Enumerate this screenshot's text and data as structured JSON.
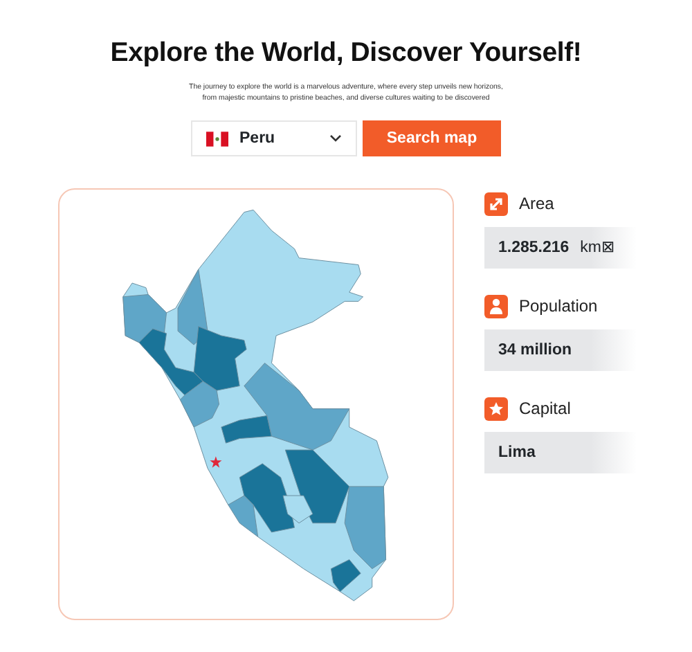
{
  "title": "Explore the World, Discover Yourself!",
  "subtitle_lines": [
    "The journey to explore the world is a marvelous adventure, where every step unveils new horizons,",
    "from majestic mountains to pristine beaches, and diverse cultures waiting to be discovered"
  ],
  "country_select": {
    "value": "Peru"
  },
  "search_button": "Search map",
  "facts": [
    {
      "kind": "area",
      "label": "Area",
      "value": "1.285.216",
      "unit": "km⊠"
    },
    {
      "kind": "population",
      "label": "Population",
      "value": "34 million"
    },
    {
      "kind": "capital",
      "label": "Capital",
      "value": "Lima"
    }
  ]
}
